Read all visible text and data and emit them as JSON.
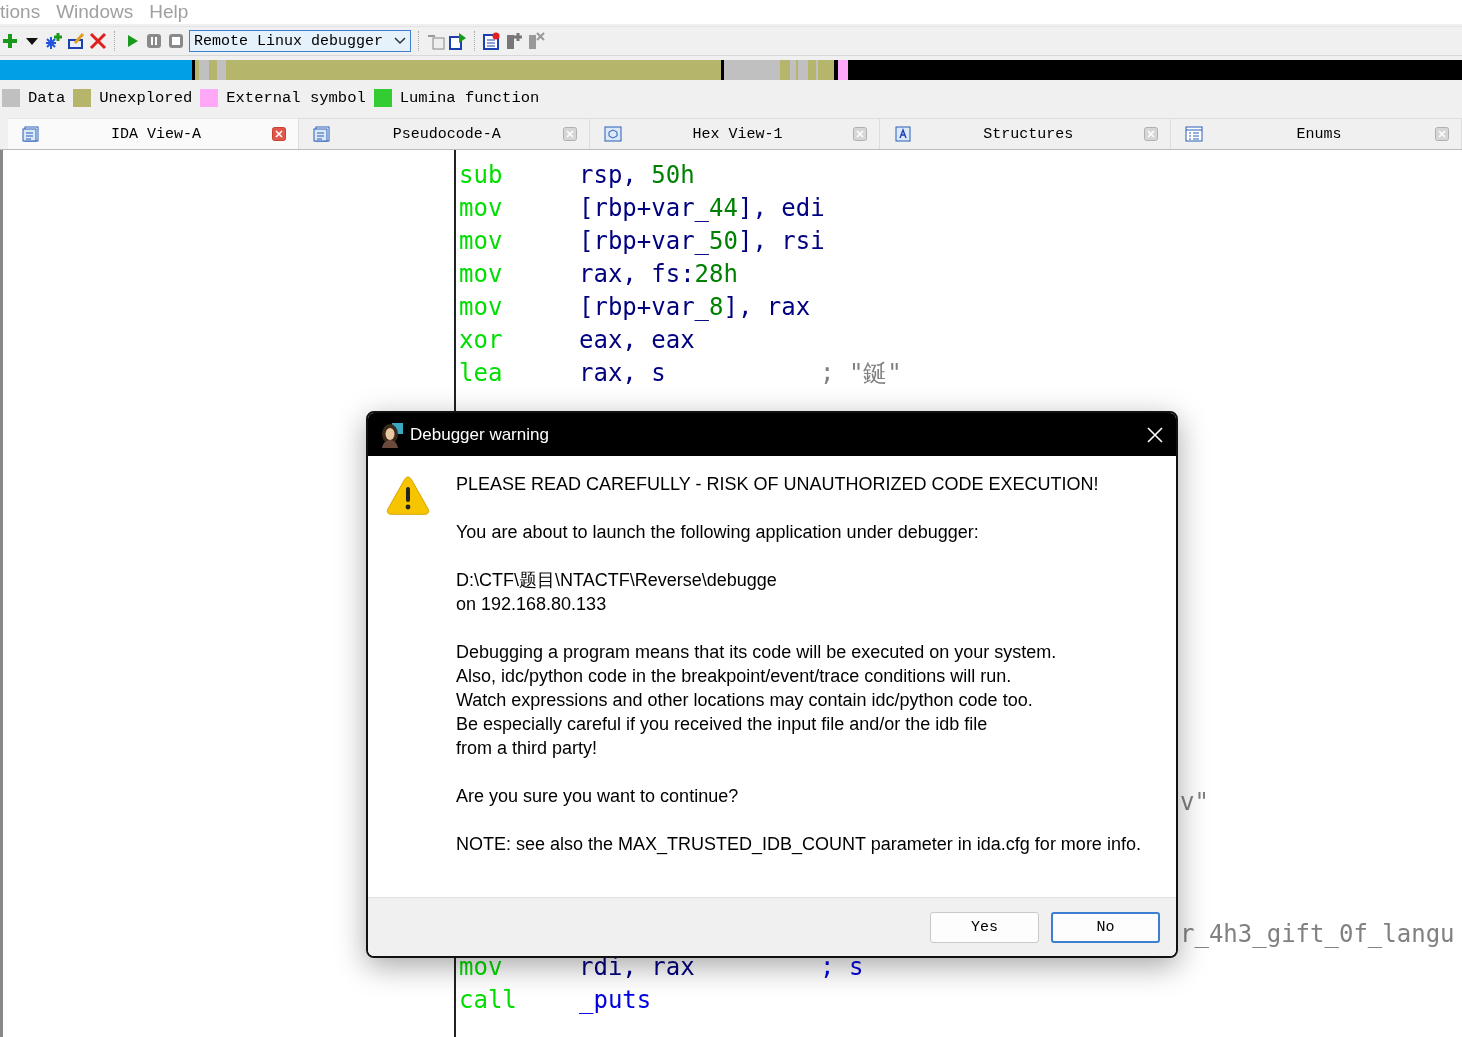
{
  "menu": [
    {
      "label": "tions"
    },
    {
      "label": "Windows"
    },
    {
      "label": "Help"
    }
  ],
  "toolbar": {
    "debugger_select": {
      "value": "Remote Linux debugger"
    }
  },
  "legend": [
    {
      "label": "Data",
      "color": "#c0c0c0"
    },
    {
      "label": "Unexplored",
      "color": "#b5b56b"
    },
    {
      "label": "External symbol",
      "color": "#ffa8f8"
    },
    {
      "label": "Lumina function",
      "color": "#33cc33"
    }
  ],
  "tabs": [
    {
      "label": "IDA View-A",
      "kind": "listing",
      "selected": true
    },
    {
      "label": "Pseudocode-A",
      "kind": "listing",
      "selected": false
    },
    {
      "label": "Hex View-1",
      "kind": "hex",
      "selected": false
    },
    {
      "label": "Structures",
      "kind": "struct",
      "selected": false
    },
    {
      "label": "Enums",
      "kind": "enum",
      "selected": false
    }
  ],
  "disassembly": {
    "lines": [
      {
        "kind": "code",
        "mnemonic": "sub",
        "operands": [
          {
            "text": "rsp, ",
            "kind": "reg"
          },
          {
            "text": "50h",
            "kind": "num"
          }
        ]
      },
      {
        "kind": "code",
        "mnemonic": "mov",
        "operands": [
          {
            "text": "[rbp+var_",
            "kind": "reg"
          },
          {
            "text": "44",
            "kind": "num"
          },
          {
            "text": "], edi",
            "kind": "reg"
          }
        ]
      },
      {
        "kind": "code",
        "mnemonic": "mov",
        "operands": [
          {
            "text": "[rbp+var_",
            "kind": "reg"
          },
          {
            "text": "50",
            "kind": "num"
          },
          {
            "text": "], rsi",
            "kind": "reg"
          }
        ]
      },
      {
        "kind": "code",
        "mnemonic": "mov",
        "operands": [
          {
            "text": "rax, fs:",
            "kind": "reg"
          },
          {
            "text": "28h",
            "kind": "num"
          }
        ]
      },
      {
        "kind": "code",
        "mnemonic": "mov",
        "operands": [
          {
            "text": "[rbp+var_",
            "kind": "reg"
          },
          {
            "text": "8",
            "kind": "num"
          },
          {
            "text": "], rax",
            "kind": "reg"
          }
        ]
      },
      {
        "kind": "code",
        "mnemonic": "xor",
        "operands": [
          {
            "text": "eax, eax",
            "kind": "reg"
          }
        ]
      },
      {
        "kind": "code",
        "mnemonic": "lea",
        "operands": [
          {
            "text": "rax, s",
            "kind": "reg"
          }
        ],
        "comment": {
          "text": "; \"鋋\"",
          "kind": "string"
        }
      },
      {
        "kind": "covered"
      },
      {
        "kind": "covered"
      },
      {
        "kind": "covered"
      },
      {
        "kind": "covered"
      },
      {
        "kind": "covered"
      },
      {
        "kind": "covered"
      },
      {
        "kind": "covered"
      },
      {
        "kind": "covered"
      },
      {
        "kind": "covered"
      },
      {
        "kind": "covered"
      },
      {
        "kind": "covered"
      },
      {
        "kind": "covered"
      },
      {
        "kind": "tail",
        "text": "v\""
      },
      {
        "kind": "covered"
      },
      {
        "kind": "covered"
      },
      {
        "kind": "covered"
      },
      {
        "kind": "tail",
        "text": "r_4h3_gift_0f_langu"
      },
      {
        "kind": "code",
        "mnemonic": "mov",
        "operands": [
          {
            "text": "rdi, rax",
            "kind": "reg"
          }
        ],
        "comment": {
          "text": "; s",
          "kind": "ref"
        }
      },
      {
        "kind": "code",
        "mnemonic": "call",
        "operands": [
          {
            "text": "_puts",
            "kind": "name"
          }
        ]
      }
    ]
  },
  "dialog": {
    "title": "Debugger warning",
    "paragraphs": [
      [
        "PLEASE READ CAREFULLY - RISK OF UNAUTHORIZED CODE EXECUTION!"
      ],
      [
        "You are about to launch the following application under debugger:"
      ],
      [
        "D:\\CTF\\题目\\NTACTF\\Reverse\\debugge",
        "on 192.168.80.133"
      ],
      [
        "Debugging a program means that its code will be executed on your system.",
        "Also, idc/python code in the breakpoint/event/trace conditions will run.",
        "Watch expressions and other locations may contain idc/python code too.",
        "Be especially careful if you received the input file and/or the idb file",
        "from a third party!"
      ],
      [
        "Are you sure you want to continue?"
      ],
      [
        "NOTE: see also the MAX_TRUSTED_IDB_COUNT parameter in ida.cfg for more info."
      ]
    ],
    "buttons": [
      {
        "label": "Yes",
        "default": false
      },
      {
        "label": "No",
        "default": true
      }
    ]
  }
}
